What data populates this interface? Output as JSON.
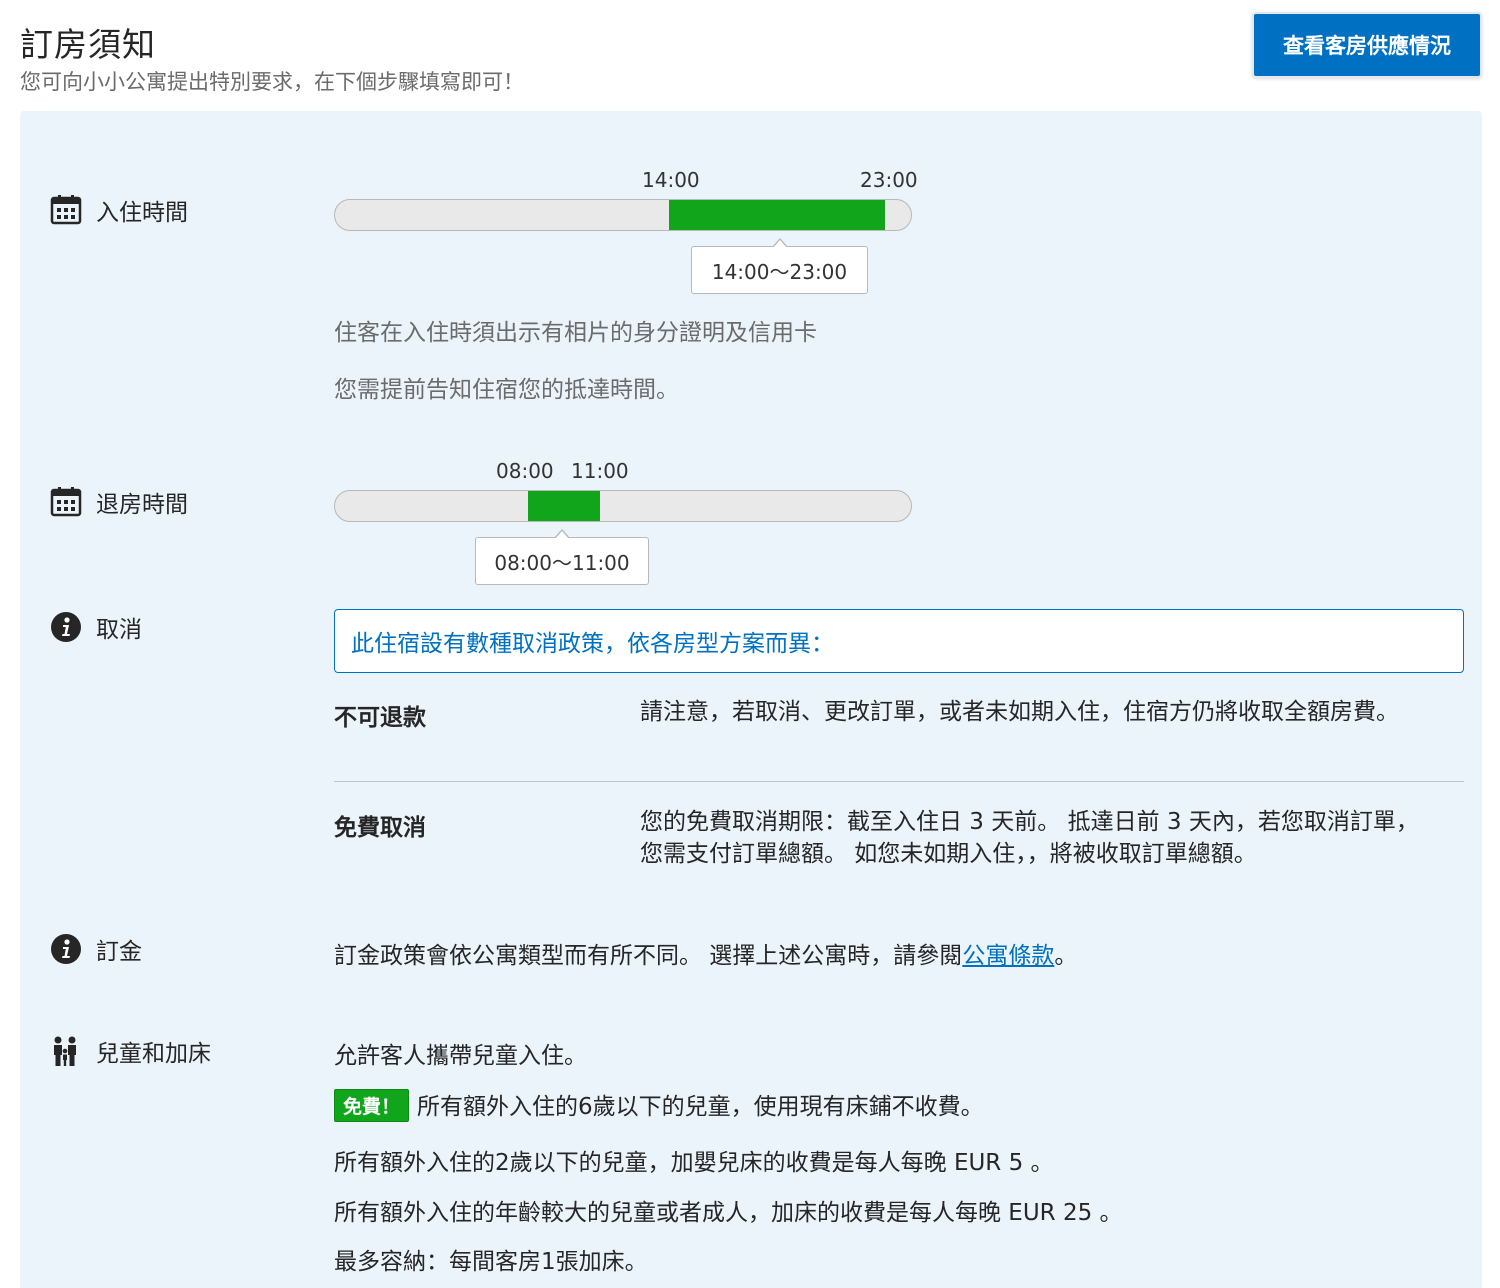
{
  "header": {
    "title": "訂房須知",
    "subtitle": "您可向小小公寓提出特別要求，在下個步驟填寫即可！",
    "availability_button": "查看客房供應情況"
  },
  "checkin": {
    "label": "入住時間",
    "start_label": "14:00",
    "end_label": "23:00",
    "range_label": "14:00～23:00",
    "range_start_fraction": 0.58,
    "range_end_fraction": 0.955,
    "notes": [
      "住客在入住時須出示有相片的身分證明及信用卡",
      "您需提前告知住宿您的抵達時間。"
    ]
  },
  "checkout": {
    "label": "退房時間",
    "start_label": "08:00",
    "end_label": "11:00",
    "range_label": "08:00～11:00",
    "range_start_fraction": 0.335,
    "range_end_fraction": 0.46
  },
  "cancellation": {
    "label": "取消",
    "banner": "此住宿設有數種取消政策，依各房型方案而異：",
    "policies": [
      {
        "name": "不可退款",
        "description": "請注意，若取消、更改訂單，或者未如期入住，住宿方仍將收取全額房費。"
      },
      {
        "name": "免費取消",
        "description": "您的免費取消期限：截至入住日 3 天前。 抵達日前 3 天內，若您取消訂單，您需支付訂單總額。 如您未如期入住，，將被收取訂單總額。"
      }
    ]
  },
  "deposit": {
    "label": "訂金",
    "text_before": "訂金政策會依公寓類型而有所不同。 選擇上述公寓時，請參閱",
    "link_text": "公寓條款",
    "text_after": "。"
  },
  "children": {
    "label": "兒童和加床",
    "allowed": "允許客人攜帶兒童入住。",
    "free_badge": "免費！",
    "free_text": "所有額外入住的6歲以下的兒童，使用現有床鋪不收費。",
    "crib_text": "所有額外入住的2歲以下的兒童，加嬰兒床的收費是每人每晚 EUR 5 。",
    "extra_bed_text": "所有額外入住的年齡較大的兒童或者成人，加床的收費是每人每晚 EUR 25 。",
    "max_text": "最多容納：每間客房1張加床。"
  },
  "icons": {
    "checkin": "calendar-icon",
    "checkout": "calendar-icon",
    "cancellation": "info-icon",
    "deposit": "info-icon",
    "children": "family-icon"
  },
  "colors": {
    "accent": "#0071c2",
    "range_fill": "#11a51b",
    "panel_bg": "#ebf3fb"
  }
}
